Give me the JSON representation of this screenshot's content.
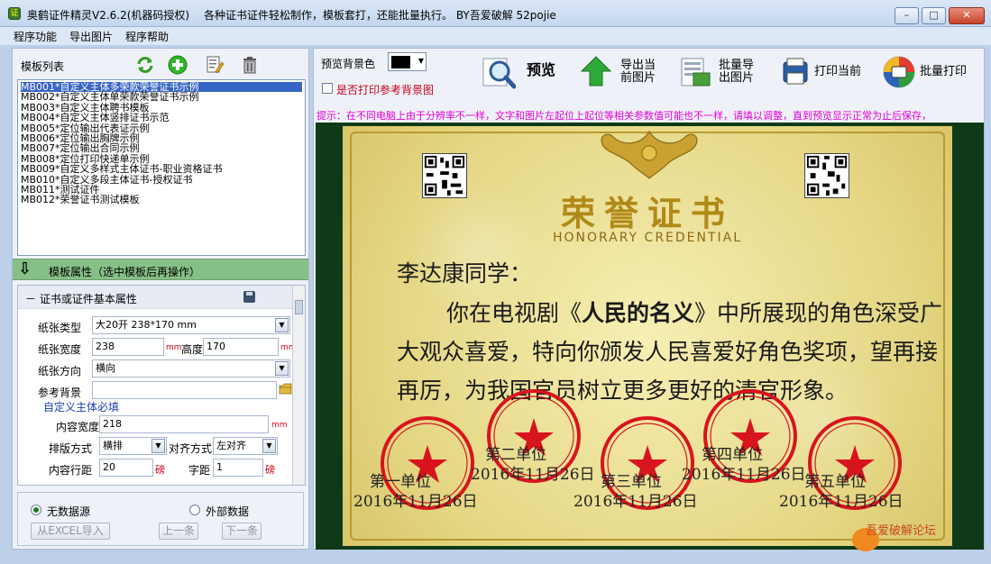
{
  "window": {
    "title": "奥鹤证件精灵V2.6.2(机器码授权)",
    "tagline": "各种证书证件轻松制作，模板套打，还能批量执行。 BY吾爱破解 52pojie",
    "controls": {
      "minimize": "–",
      "maximize": "□",
      "close": "✕"
    }
  },
  "menu": [
    "程序功能",
    "导出图片",
    "程序帮助"
  ],
  "template_panel": {
    "title": "模板列表",
    "templates": [
      "MB001*自定义主体多荣款荣誉证书示例",
      "MB002*自定义主体单荣款荣誉证书示例",
      "MB003*自定义主体聘书模板",
      "MB004*自定义主体竖排证书示范",
      "MB005*定位输出代表证示例",
      "MB006*定位输出胸牌示例",
      "MB007*定位输出合同示例",
      "MB008*定位打印快递单示例",
      "MB009*自定义多样式主体证书-职业资格证书",
      "MB010*自定义多段主体证书-授权证书",
      "MB011*测试证件",
      "MB012*荣誉证书测试模板"
    ],
    "selected_index": 0
  },
  "properties": {
    "header": "模板属性（选中模板后再操作）",
    "category": "证书或证件基本属性",
    "paper_type_label": "纸张类型",
    "paper_type_value": "大20开 238*170 mm",
    "paper_width_label": "纸张宽度",
    "paper_width_value": "238",
    "height_label": "高度",
    "height_value": "170",
    "unit_mm": "mm",
    "orientation_label": "纸张方向",
    "orientation_value": "横向",
    "bg_label": "参考背景",
    "bg_value": "",
    "section_title": "自定义主体必填",
    "content_width_label": "内容宽度",
    "content_width_value": "218",
    "layout_label": "排版方式",
    "layout_value": "横排",
    "align_label": "对齐方式",
    "align_value": "左对齐",
    "line_spacing_label": "内容行距",
    "line_spacing_value": "20",
    "unit_pound": "磅",
    "char_spacing_label": "字距",
    "char_spacing_value": "1"
  },
  "data_source": {
    "no_source": "无数据源",
    "external": "外部数据",
    "import_excel": "从EXCEL导入",
    "prev": "上一条",
    "next": "下一条"
  },
  "toolbar": {
    "preview_bg_label": "预览背景色",
    "preview_bg_color": "#000000",
    "print_ref_bg": "是否打印参考背景图",
    "preview": "预览",
    "export_current": "导出当\n前图片",
    "export_current_l1": "导出当",
    "export_current_l2": "前图片",
    "batch_export_l1": "批量导",
    "batch_export_l2": "出图片",
    "print_current": "打印当前",
    "batch_print": "批量打印"
  },
  "hint": "提示：在不同电脑上由于分辨率不一样，文字和图片左起位上起位等相关参数值可能也不一样，请填以调整，直到预览显示正常为止后保存，",
  "certificate": {
    "title": "荣誉证书",
    "subtitle": "HONORARY CREDENTIAL",
    "salutation": "李达康同学：",
    "body_pre": "你在电视剧《",
    "body_show": "人民的名义",
    "body_post": "》中所展现的角色深受广大观众喜爱，特向你颁发人民喜爱好角色奖项，望再接再厉，为我国官员树立更多更好的清官形象。",
    "seals": [
      {
        "unit": "第一单位",
        "date": "2016年11月26日"
      },
      {
        "unit": "第二单位",
        "date": "2016年11月26日"
      },
      {
        "unit": "第三单位",
        "date": "2016年11月26日"
      },
      {
        "unit": "第四单位",
        "date": "2016年11月26日"
      },
      {
        "unit": "第五单位",
        "date": "2016年11月26日"
      }
    ],
    "seal_color": "#d8141e"
  },
  "watermark": "吾爱破解论坛"
}
